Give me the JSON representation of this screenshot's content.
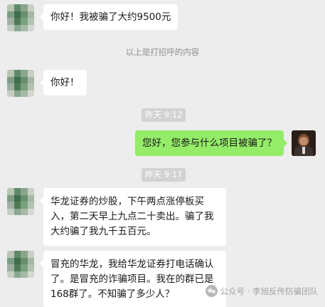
{
  "messages": [
    {
      "side": "left",
      "text": "你好！我被骗了大约9500元"
    },
    {
      "side": "left",
      "text": "你好！"
    },
    {
      "side": "right",
      "text": "您好，您参与什么项目被骗了？"
    },
    {
      "side": "left",
      "lines": [
        "华龙证券的炒股，下午两点涨停板买",
        "入，第二天早上九点二十卖出。骗了我",
        "大约骗了我九千五百元。"
      ]
    },
    {
      "side": "left",
      "lines": [
        "冒充的华龙，我给华龙证券打电话确认",
        "了。是冒充的诈骗项目。我在的群已是",
        "168群了。不知骗了多少人？"
      ]
    }
  ],
  "system_notice": "以上是打招呼的内容",
  "timestamps": [
    "昨天 9:12",
    "昨天 9:17"
  ],
  "watermark": {
    "icon": "wechat-official-account-icon",
    "text": "公众号 · 李旭反传防骗团队"
  },
  "colors": {
    "background": "#ededed",
    "self_bubble": "#95ec69",
    "other_bubble": "#ffffff"
  }
}
